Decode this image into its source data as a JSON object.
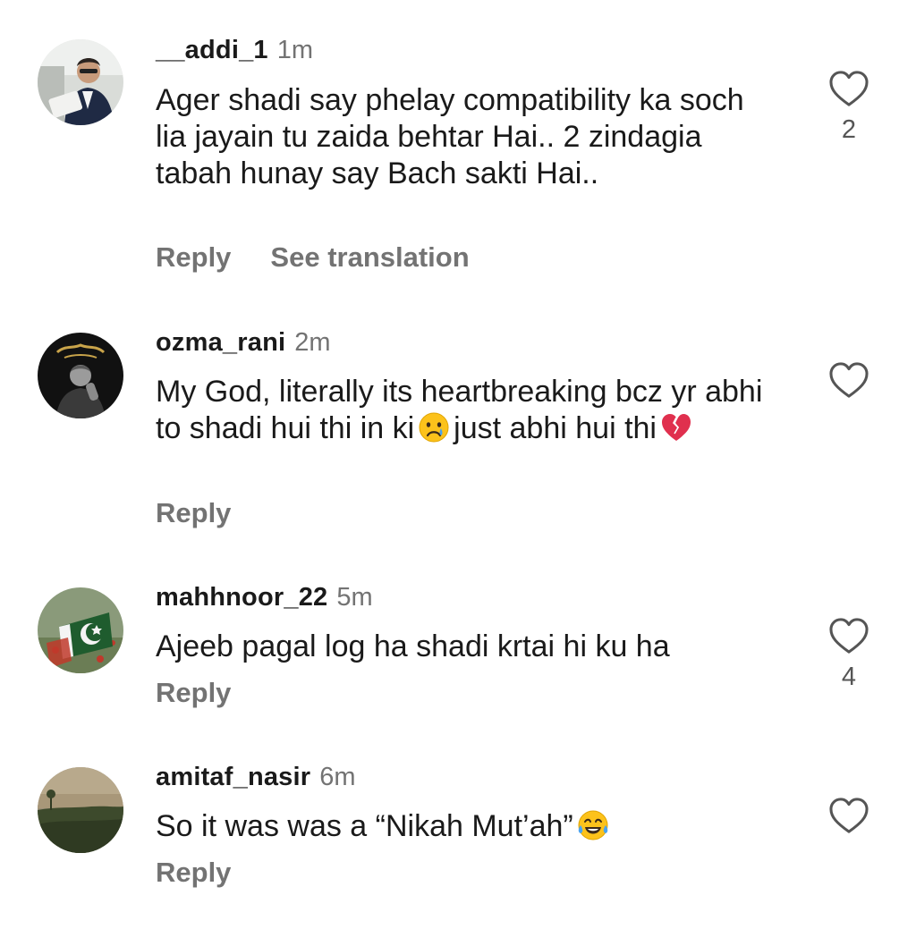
{
  "comments": [
    {
      "username": "__addi_1",
      "time": "1m",
      "text": "Ager shadi say phelay compatibility ka soch lia jayain tu zaida behtar Hai.. 2 zindagia tabah hunay say Bach sakti Hai..",
      "likes": "2",
      "reply_label": "Reply",
      "translate_label": "See translation"
    },
    {
      "username": "ozma_rani",
      "time": "2m",
      "text_part1": "My God, literally its heartbreaking bcz yr abhi to shadi hui thi in ki",
      "text_part2": "just abhi hui thi",
      "emoji1": "crying-face-emoji",
      "emoji2": "broken-heart-emoji",
      "likes": "",
      "reply_label": "Reply"
    },
    {
      "username": "mahhnoor_22",
      "time": "5m",
      "text": "Ajeeb pagal log ha shadi krtai hi ku ha",
      "likes": "4",
      "reply_label": "Reply"
    },
    {
      "username": "amitaf_nasir",
      "time": "6m",
      "text": "So it was was a “Nikah Mut’ah”",
      "emoji": "tears-of-joy-emoji",
      "likes": "",
      "reply_label": "Reply"
    }
  ],
  "colors": {
    "text": "#1a1a1a",
    "muted": "#737373",
    "background": "#ffffff"
  }
}
